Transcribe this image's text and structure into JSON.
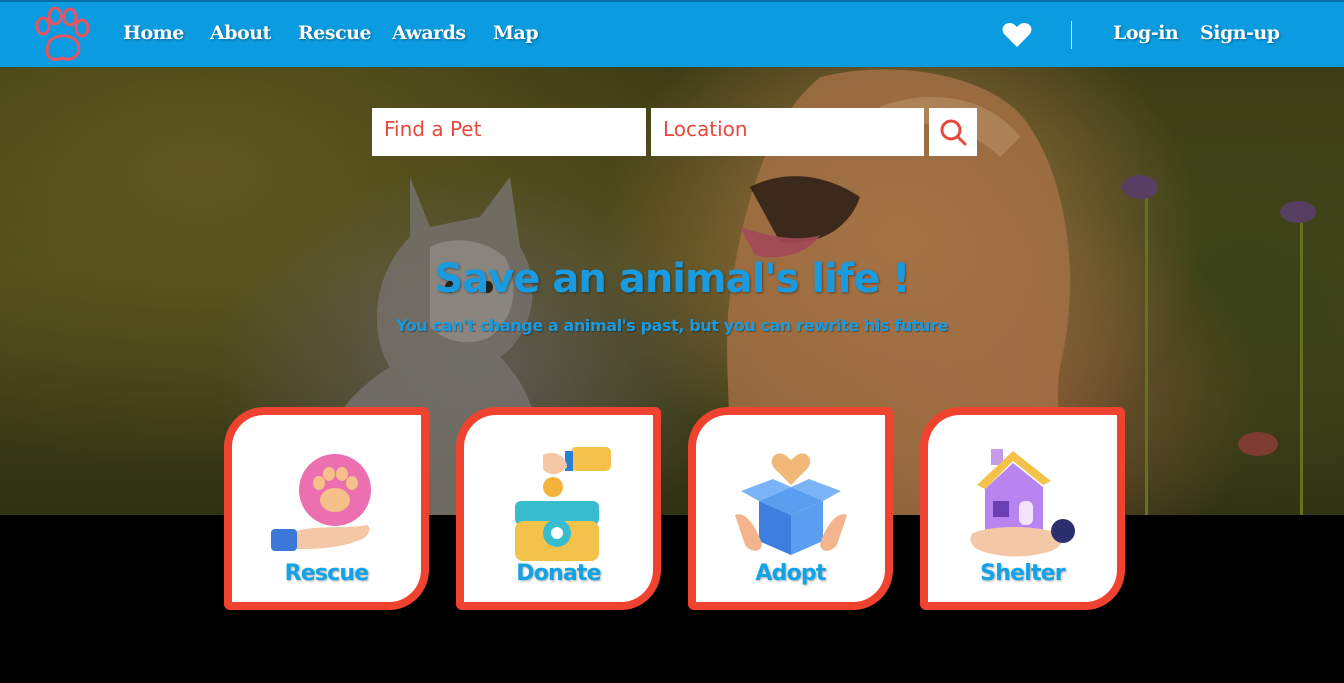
{
  "nav": {
    "links": [
      "Home",
      "About",
      "Rescue",
      "Awards",
      "Map"
    ],
    "login": "Log-in",
    "signup": "Sign-up",
    "icons": {
      "logo": "paw-logo",
      "favorites": "heart-icon"
    }
  },
  "search": {
    "pet_placeholder": "Find a Pet",
    "location_placeholder": "Location",
    "button_icon": "search-icon"
  },
  "hero": {
    "headline": "Save an animal's life !",
    "subline": "You can't change a animal's past, but you can rewrite his future"
  },
  "cards": [
    {
      "label": "Rescue",
      "icon": "paw-hand-icon"
    },
    {
      "label": "Donate",
      "icon": "donation-box-icon"
    },
    {
      "label": "Adopt",
      "icon": "gift-heart-icon"
    },
    {
      "label": "Shelter",
      "icon": "house-hand-icon"
    }
  ],
  "colors": {
    "nav_bg": "#0a9be0",
    "accent_red": "#f0432f",
    "title_blue": "#1a9be0",
    "search_text": "#e8493c"
  }
}
